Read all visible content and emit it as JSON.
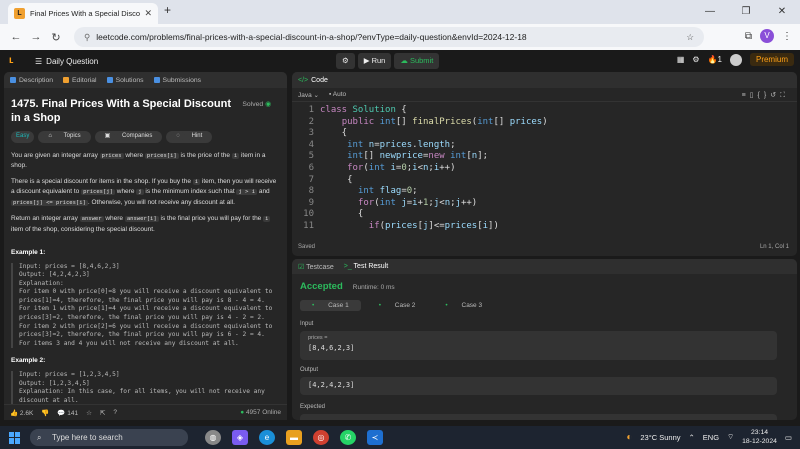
{
  "browser": {
    "tab_title": "Final Prices With a Special Discou",
    "url": "leetcode.com/problems/final-prices-with-a-special-discount-in-a-shop/?envType=daily-question&envId=2024-12-18",
    "avatar_letter": "V"
  },
  "lc_nav": {
    "daily_label": "Daily Question",
    "run_label": "Run",
    "submit_label": "Submit",
    "streak": "1",
    "premium_label": "Premium"
  },
  "left": {
    "tabs": [
      "Description",
      "Editorial",
      "Solutions",
      "Submissions"
    ],
    "title": "1475. Final Prices With a Special Discount in a Shop",
    "solved": "Solved",
    "tags": [
      "Easy",
      "Topics",
      "Companies",
      "Hint"
    ],
    "p1_a": "You are given an integer array",
    "p1_code1": "prices",
    "p1_b": "where",
    "p1_code2": "prices[i]",
    "p1_c": "is the price of the",
    "p1_code3": "i",
    "p1_d": "item in a shop.",
    "p2": "There is a special discount for items in the shop. If you buy the",
    "p2_code1": "i",
    "p2_b": "item, then you will receive a discount equivalent to",
    "p2_code2": "prices[j]",
    "p2_c": "where",
    "p2_code3": "j",
    "p2_d": "is the minimum index such that",
    "p2_code4": "j > i",
    "p2_e": "and",
    "p2_code5": "prices[j] <= prices[i]",
    "p2_f": ". Otherwise, you will not receive any discount at all.",
    "p3_a": "Return an integer array",
    "p3_code1": "answer",
    "p3_b": "where",
    "p3_code2": "answer[i]",
    "p3_c": "is the final price you will pay for the",
    "p3_code3": "i",
    "p3_d": "item of the shop, considering the special discount.",
    "ex1_title": "Example 1:",
    "ex1_lines": [
      "Input: prices = [8,4,6,2,3]",
      "Output: [4,2,4,2,3]",
      "Explanation:",
      "For item 0 with price[0]=8 you will receive a discount equivalent to",
      "prices[1]=4, therefore, the final price you will pay is 8 - 4 = 4.",
      "For item 1 with price[1]=4 you will receive a discount equivalent to",
      "prices[3]=2, therefore, the final price you will pay is 4 - 2 = 2.",
      "For item 2 with price[2]=6 you will receive a discount equivalent to",
      "prices[3]=2, therefore, the final price you will pay is 6 - 2 = 4.",
      "For items 3 and 4 you will not receive any discount at all."
    ],
    "ex2_title": "Example 2:",
    "ex2_lines": [
      "Input: prices = [1,2,3,4,5]",
      "Output: [1,2,3,4,5]",
      "Explanation: In this case, for all items, you will not receive any",
      "discount at all."
    ],
    "likes": "2.6K",
    "comments": "141",
    "online": "4957 Online"
  },
  "code": {
    "tab_label": "Code",
    "language": "Java",
    "auto": "Auto",
    "lines": [
      "class Solution {",
      "    public int[] finalPrices(int[] prices)",
      "    {",
      "     int n=prices.length;",
      "     int[] newprice=new int[n];",
      "     for(int i=0;i<n;i++)",
      "     {",
      "       int flag=0;",
      "       for(int j=i+1;j<n;j++)",
      "       {",
      "         if(prices[j]<=prices[i])"
    ],
    "status": "Saved",
    "position": "Ln 1, Col 1"
  },
  "result": {
    "tabs": [
      "Testcase",
      "Test Result"
    ],
    "verdict": "Accepted",
    "runtime": "Runtime: 0 ms",
    "cases": [
      "Case 1",
      "Case 2",
      "Case 3"
    ],
    "input_label": "Input",
    "input_var": "prices =",
    "input_value": "[8,4,6,2,3]",
    "output_label": "Output",
    "output_value": "[4,2,4,2,3]",
    "expected_label": "Expected"
  },
  "taskbar": {
    "search_placeholder": "Type here to search",
    "weather": "23°C  Sunny",
    "lang": "ENG",
    "time": "23:14",
    "date": "18-12-2024"
  }
}
